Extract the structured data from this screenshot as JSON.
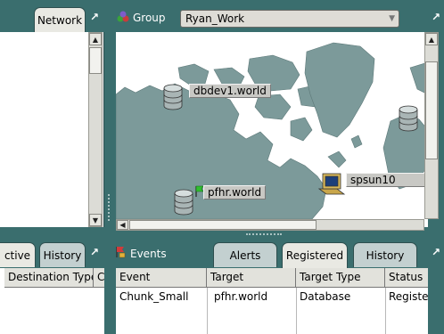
{
  "network_panel": {
    "tab_label": "Network"
  },
  "group_panel": {
    "label": "Group",
    "selected_group": "Ryan_Work",
    "map_nodes": [
      {
        "name": "dbdev1.world",
        "kind": "database"
      },
      {
        "name": "pfhr.world",
        "kind": "database"
      },
      {
        "name": "spsun10",
        "kind": "workstation"
      }
    ]
  },
  "jobs_panel": {
    "tabs": [
      "ctive",
      "History"
    ],
    "columns": [
      "Destination Type",
      "C"
    ]
  },
  "events_panel": {
    "label": "Events",
    "tabs": [
      "Alerts",
      "Registered",
      "History"
    ],
    "active_tab": "Registered",
    "columns": [
      "Event",
      "Target",
      "Target Type",
      "Status"
    ],
    "rows": [
      {
        "event": "Chunk_Small",
        "target": "pfhr.world",
        "target_type": "Database",
        "status": "Registere"
      }
    ]
  },
  "colors": {
    "frame": "#3a6e6e",
    "sea": "#ffffff",
    "land": "#7c9a9a"
  }
}
